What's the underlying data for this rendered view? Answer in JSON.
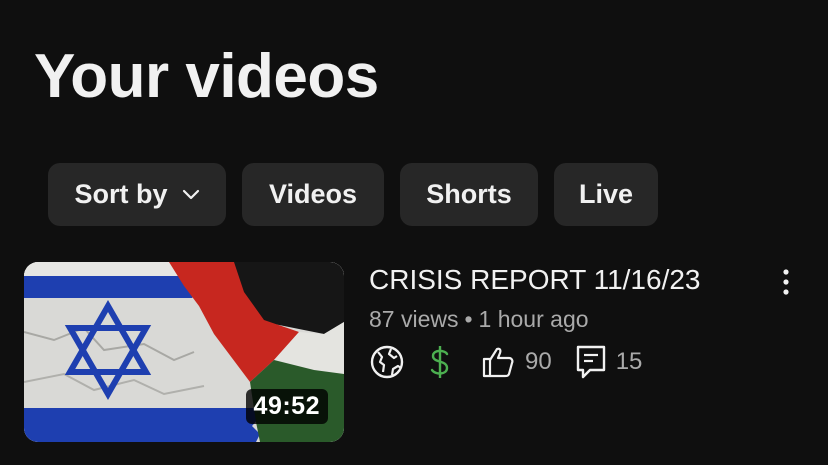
{
  "page": {
    "title": "Your videos"
  },
  "filters": {
    "sort_label": "Sort by",
    "chips": [
      {
        "label": "Videos"
      },
      {
        "label": "Shorts"
      },
      {
        "label": "Live"
      }
    ]
  },
  "videos": [
    {
      "title": "CRISIS REPORT 11/16/23",
      "views": "87 views",
      "separator": "•",
      "time_ago": "1 hour ago",
      "duration": "49:52",
      "visibility_icon": "globe-icon",
      "monetization_icon": "dollar-icon",
      "monetization_color": "#4caf50",
      "likes": "90",
      "comments": "15"
    }
  ],
  "colors": {
    "background": "#0f0f0f",
    "chip_bg": "#272727",
    "text_primary": "#f1f1f1",
    "text_secondary": "#aaaaaa"
  }
}
